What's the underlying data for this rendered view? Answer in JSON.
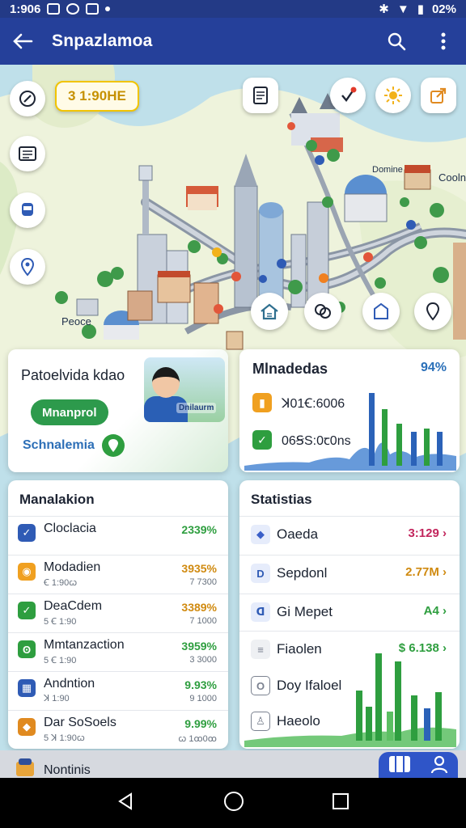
{
  "status_bar": {
    "time": "1:906",
    "battery": "02%"
  },
  "app_bar": {
    "title": "Snpazlamoa"
  },
  "map": {
    "time_chip": "3 1:90HE",
    "labels": {
      "domine": "Domine",
      "coolo": "Cooln",
      "peoce": "Peoce"
    }
  },
  "profile_card": {
    "name": "Patoelvida kdao",
    "pill": "Mnanprol",
    "location": "Schnalemia",
    "image_label": "Dnilaurm"
  },
  "media_card": {
    "title": "Mlnadedas",
    "percent": "94%",
    "rows": [
      {
        "label": "ꓘ01Ꞓ:6006",
        "color": "#f0a020"
      },
      {
        "label": "06ꞨS:0ꞇ0ns",
        "color": "#2e9e3f"
      }
    ]
  },
  "list_card": {
    "title": "Manalakion",
    "items": [
      {
        "label": "Cloclacia",
        "sub": "",
        "value": "2339%",
        "vsub": "",
        "icon_color": "#2f5bb5",
        "icon_glyph": "✓"
      },
      {
        "label": "Modadien",
        "sub": "Ꞓ 1:90ꞷ",
        "value": "3935%",
        "vsub": "7 7300",
        "icon_color": "#f0a020",
        "icon_glyph": "◉"
      },
      {
        "label": "DeaCdem",
        "sub": "5 Ꞓ 1:90",
        "value": "3389%",
        "vsub": "7 1000",
        "icon_color": "#2e9e3f",
        "icon_glyph": "✓"
      },
      {
        "label": "Mmtanzaction",
        "sub": "5 Ꞓ 1:90",
        "value": "3959%",
        "vsub": "3 3000",
        "icon_color": "#2e9e3f",
        "icon_glyph": "ʘ"
      },
      {
        "label": "Andntion",
        "sub": "ꓘ 1:90",
        "value": "9.93%",
        "vsub": "9 1000",
        "icon_color": "#2f5bb5",
        "icon_glyph": "▦"
      },
      {
        "label": "Dar SoSoels",
        "sub": "5 ꓘ 1:90ꞷ",
        "value": "9.99%",
        "vsub": "ꞷ 1ꝏ0ꝏ",
        "icon_color": "#e08a20",
        "icon_glyph": "◆"
      }
    ]
  },
  "stats_card": {
    "title": "Statistias",
    "items": [
      {
        "label": "Oaeda",
        "value": "3:129 ›",
        "value_color": "#c2255c",
        "icon_color": "#3a5fc8",
        "icon_bg": "#e6ecfb",
        "icon_glyph": "◆"
      },
      {
        "label": "Sepdonl",
        "value": "2.77M ›",
        "value_color": "#d08a10",
        "icon_color": "#2f5bb5",
        "icon_bg": "#e6ecfb",
        "icon_glyph": "D"
      },
      {
        "label": "Gi Mepet",
        "value": "A4 ›",
        "value_color": "#2e9e3f",
        "icon_color": "#2f5bb5",
        "icon_bg": "#e6ecfb",
        "icon_glyph": "ᗡ"
      },
      {
        "label": "Fiaolen",
        "value": "$ 6.138 ›",
        "value_color": "#2e9e3f",
        "icon_color": "#7b8290",
        "icon_bg": "#eef0f3",
        "icon_glyph": "≡"
      },
      {
        "label": "Doy Ifaloel",
        "value": "",
        "value_color": "#2e9e3f",
        "icon_color": "#7b8290",
        "icon_bg": "#ffffff",
        "icon_glyph": "O"
      },
      {
        "label": "Haeolo",
        "value": "",
        "value_color": "#2e9e3f",
        "icon_color": "#7b8290",
        "icon_bg": "#ffffff",
        "icon_glyph": "♙"
      }
    ]
  },
  "bottom_strip": {
    "label": "Nontinis"
  },
  "colors": {
    "primary": "#25409a",
    "accent": "#2f55c8",
    "green": "#2e9e3f"
  }
}
